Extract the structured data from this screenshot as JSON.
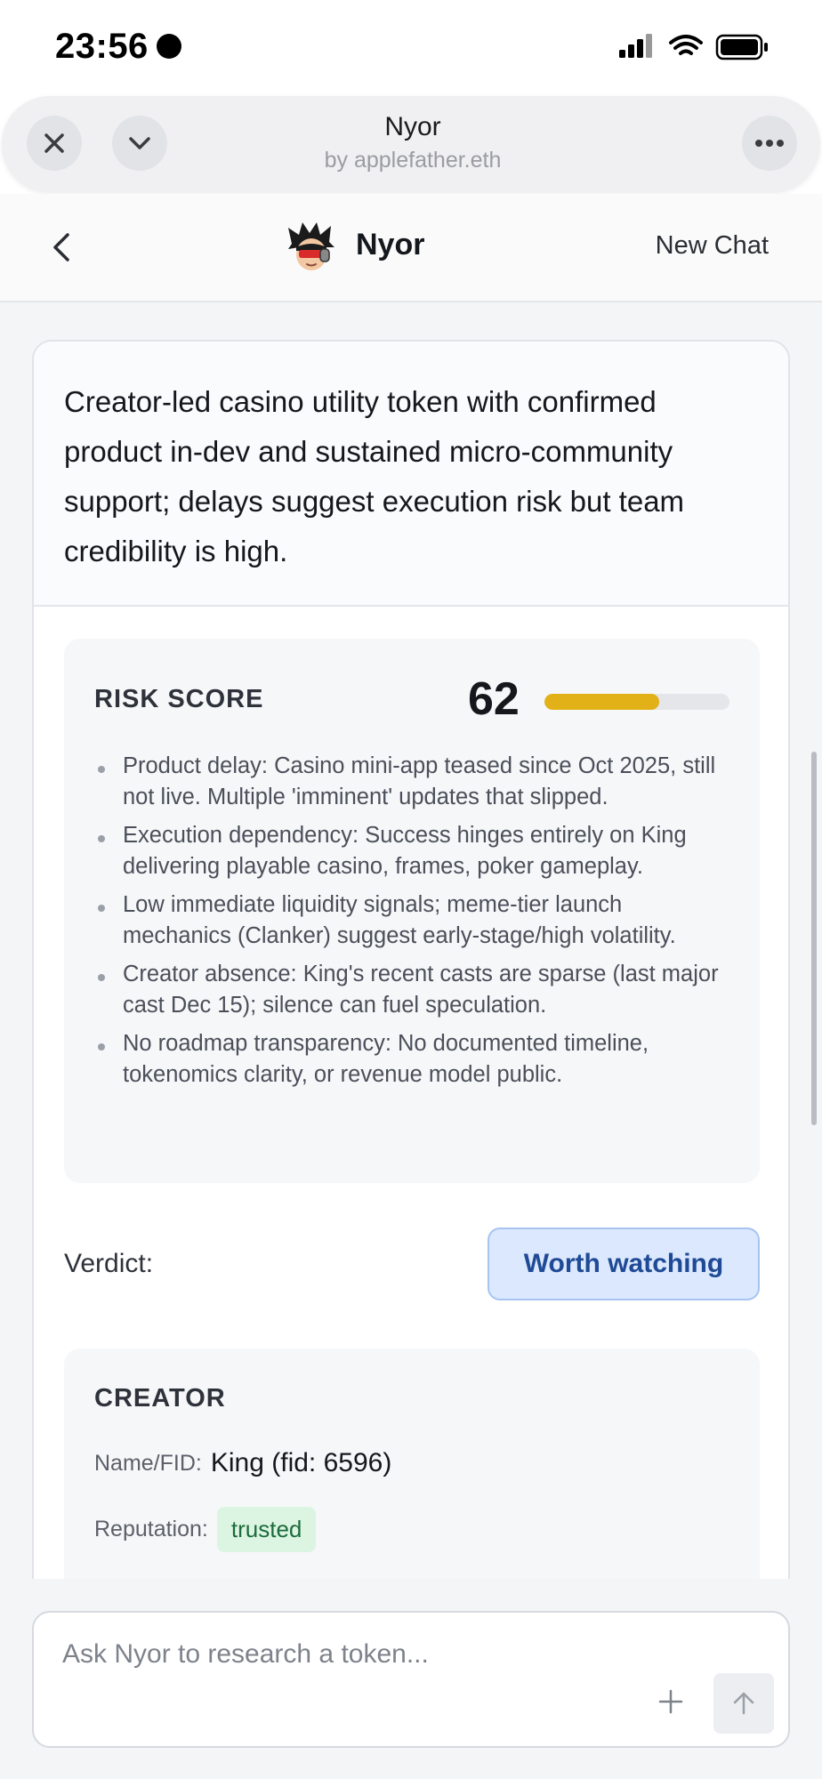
{
  "status_bar": {
    "time": "23:56"
  },
  "sheet": {
    "title": "Nyor",
    "subtitle": "by applefather.eth",
    "close_icon": "close-icon",
    "collapse_icon": "chevron-down-icon",
    "more_icon": "more-horizontal-icon"
  },
  "nav": {
    "app_name": "Nyor",
    "new_chat_label": "New Chat"
  },
  "analysis": {
    "summary": "Creator-led casino utility token with confirmed product in-dev and sustained micro-community support; delays suggest execution risk but team credibility is high.",
    "risk": {
      "label": "RISK SCORE",
      "score": "62",
      "score_value": 62,
      "score_max": 100,
      "bar_color": "#e2b118",
      "items": [
        "Product delay: Casino mini-app teased since Oct 2025, still not live. Multiple 'imminent' updates that slipped.",
        "Execution dependency: Success hinges entirely on King delivering playable casino, frames, poker gameplay.",
        "Low immediate liquidity signals; meme-tier launch mechanics (Clanker) suggest early-stage/high volatility.",
        "Creator absence: King's recent casts are sparse (last major cast Dec 15); silence can fuel speculation.",
        "No roadmap transparency: No documented timeline, tokenomics clarity, or revenue model public."
      ]
    },
    "verdict": {
      "label": "Verdict:",
      "value": "Worth watching"
    },
    "creator": {
      "label": "CREATOR",
      "name_key": "Name/FID:",
      "name_value": "King (fid: 6596)",
      "reputation_key": "Reputation:",
      "reputation_value": "trusted"
    }
  },
  "composer": {
    "placeholder": "Ask Nyor to research a token...",
    "value": ""
  }
}
